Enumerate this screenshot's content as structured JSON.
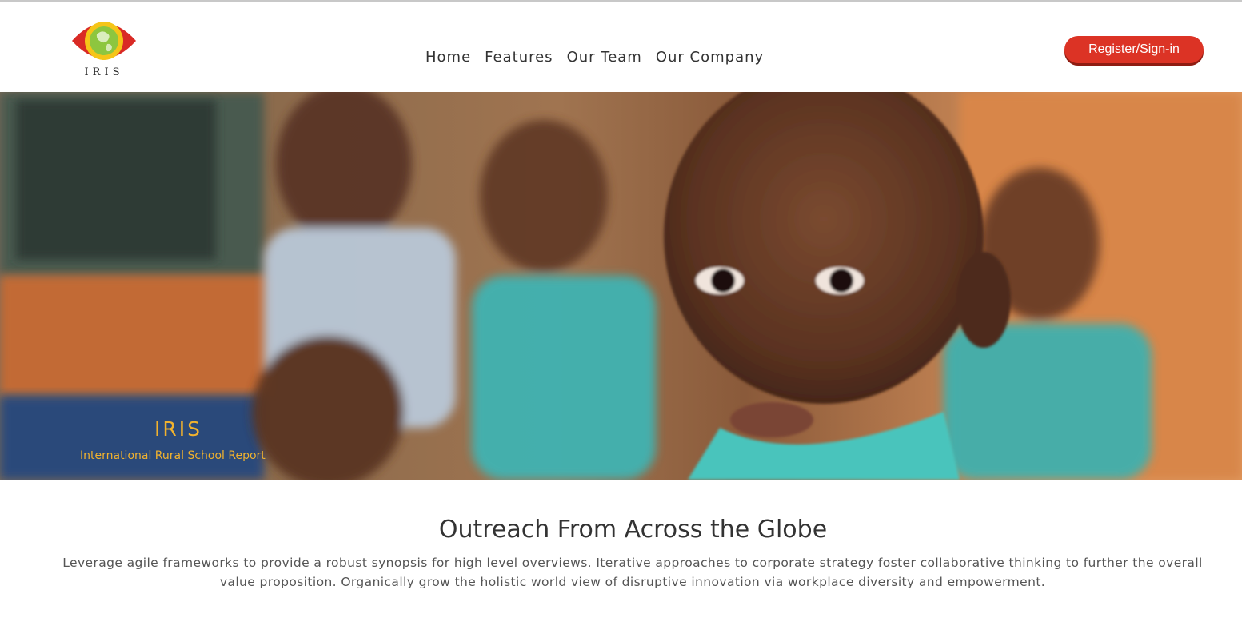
{
  "header": {
    "logo_text": "IRIS",
    "nav_items": [
      {
        "label": "Home"
      },
      {
        "label": "Features"
      },
      {
        "label": "Our Team"
      },
      {
        "label": "Our Company"
      }
    ],
    "register_label": "Register/Sign-in"
  },
  "hero": {
    "title": "IRIS",
    "subtitle": "International Rural School Report"
  },
  "section": {
    "heading": "Outreach From Across the Globe",
    "body": "Leverage agile frameworks to provide a robust synopsis for high level overviews. Iterative approaches to corporate strategy foster collaborative thinking to further the overall value proposition. Organically grow the holistic world view of disruptive innovation via workplace diversity and empowerment."
  },
  "colors": {
    "accent_red": "#dc3325",
    "hero_text_gold": "#f1b22e",
    "logo_green": "#8dc63f",
    "logo_yellow": "#f5c518"
  }
}
